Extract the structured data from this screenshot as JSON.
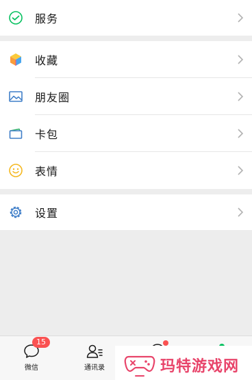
{
  "menu": {
    "service": {
      "label": "服务",
      "icon": "wechat-pay-icon"
    },
    "favorites": {
      "label": "收藏",
      "icon": "cube-icon"
    },
    "moments": {
      "label": "朋友圈",
      "icon": "picture-icon"
    },
    "cards": {
      "label": "卡包",
      "icon": "card-wallet-icon"
    },
    "stickers": {
      "label": "表情",
      "icon": "smiley-icon"
    },
    "settings": {
      "label": "设置",
      "icon": "gear-icon"
    }
  },
  "tabbar": {
    "chats": {
      "label": "微信",
      "badge": "15"
    },
    "contacts": {
      "label": "通讯录"
    },
    "discover": {
      "label": ""
    },
    "me": {
      "label": ""
    }
  },
  "watermark": {
    "text": "玛特游戏网"
  },
  "colors": {
    "background": "#ededed",
    "card": "#ffffff",
    "text": "#191919",
    "badge": "#fa5151",
    "green": "#07c160",
    "watermark": "#e8446a"
  }
}
